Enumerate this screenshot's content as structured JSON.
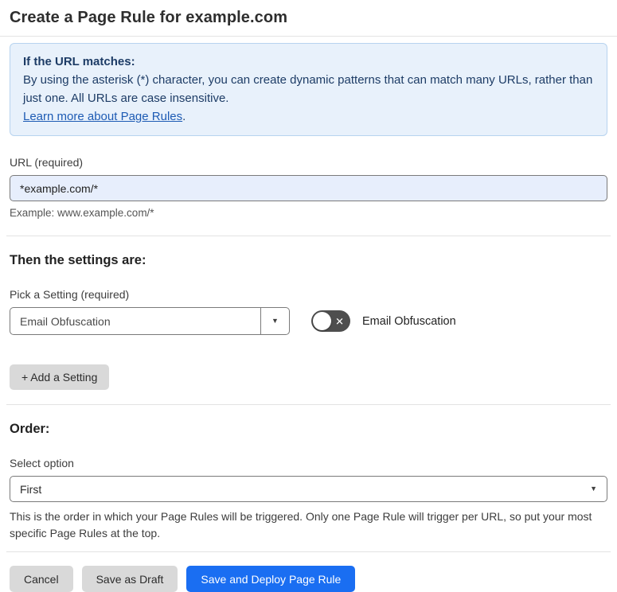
{
  "page": {
    "title": "Create a Page Rule for example.com"
  },
  "info_box": {
    "heading": "If the URL matches:",
    "body": "By using the asterisk (*) character, you can create dynamic patterns that can match many URLs, rather than just one. All URLs are case insensitive.",
    "link_label": "Learn more about Page Rules",
    "link_suffix": "."
  },
  "url_field": {
    "label": "URL (required)",
    "value": "*example.com/*",
    "example": "Example: www.example.com/*"
  },
  "settings": {
    "heading": "Then the settings are:",
    "pick_label": "Pick a Setting (required)",
    "selected_setting": "Email Obfuscation",
    "toggle_label": "Email Obfuscation",
    "toggle_state": "off",
    "add_button_label": "+ Add a Setting"
  },
  "order": {
    "heading": "Order:",
    "select_label": "Select option",
    "selected_option": "First",
    "help_text": "This is the order in which your Page Rules will be triggered. Only one Page Rule will trigger per URL, so put your most specific Page Rules at the top."
  },
  "footer": {
    "cancel_label": "Cancel",
    "save_draft_label": "Save as Draft",
    "save_deploy_label": "Save and Deploy Page Rule"
  },
  "icons": {
    "dropdown_arrow": "▼",
    "toggle_off_x": "✕"
  },
  "colors": {
    "accent_blue": "#1a6ef2",
    "info_bg": "#e8f1fb",
    "info_border": "#b7d3ef",
    "info_text": "#1d3c66",
    "link_blue": "#1d5bb4",
    "input_bg": "#e7eefc",
    "gray_button_bg": "#d9d9d9",
    "toggle_off_bg": "#4e4e4e"
  }
}
